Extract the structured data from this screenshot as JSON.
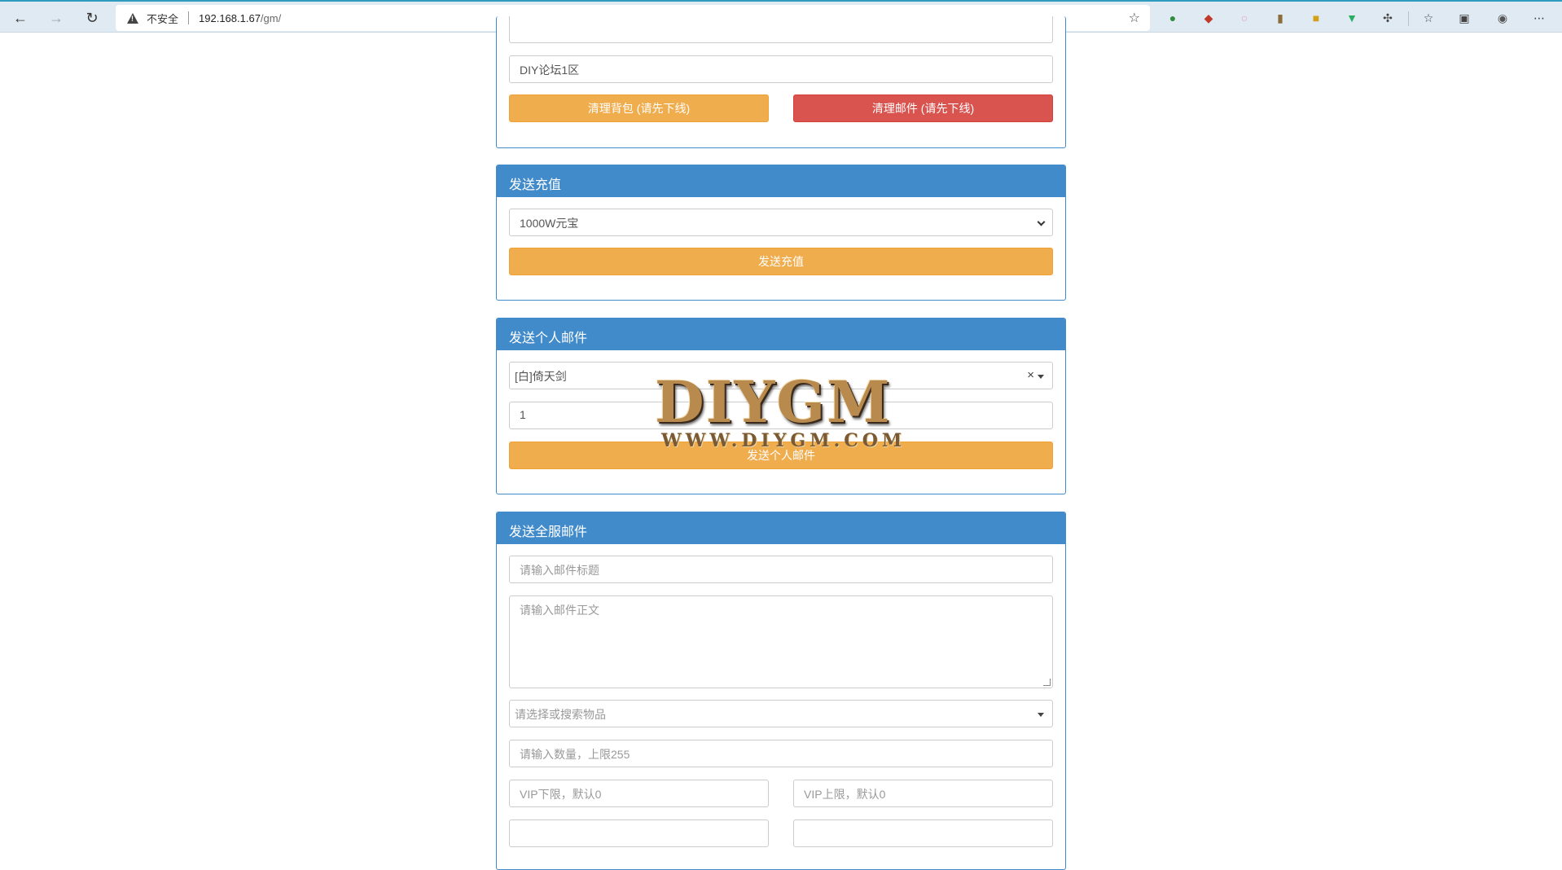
{
  "browser": {
    "insecure_label": "不安全",
    "url_host": "192.168.1.67",
    "url_path": "/gm/"
  },
  "player_panel": {
    "server_value": "DIY论坛1区",
    "clear_bag_label": "清理背包 (请先下线)",
    "clear_mail_label": "清理邮件 (请先下线)"
  },
  "recharge_panel": {
    "title": "发送充值",
    "selected_option": "1000W元宝",
    "send_label": "发送充值"
  },
  "personal_mail_panel": {
    "title": "发送个人邮件",
    "item_value": "[白]倚天剑",
    "clear_symbol": "×",
    "quantity_value": "1",
    "send_label": "发送个人邮件"
  },
  "server_mail_panel": {
    "title": "发送全服邮件",
    "subject_placeholder": "请输入邮件标题",
    "body_placeholder": "请输入邮件正文",
    "item_placeholder": "请选择或搜索物品",
    "quantity_placeholder": "请输入数量，上限255",
    "vip_min_placeholder": "VIP下限，默认0",
    "vip_max_placeholder": "VIP上限，默认0"
  },
  "watermark": {
    "brand": "DIYGM",
    "site": "WWW.DIYGM.COM"
  }
}
